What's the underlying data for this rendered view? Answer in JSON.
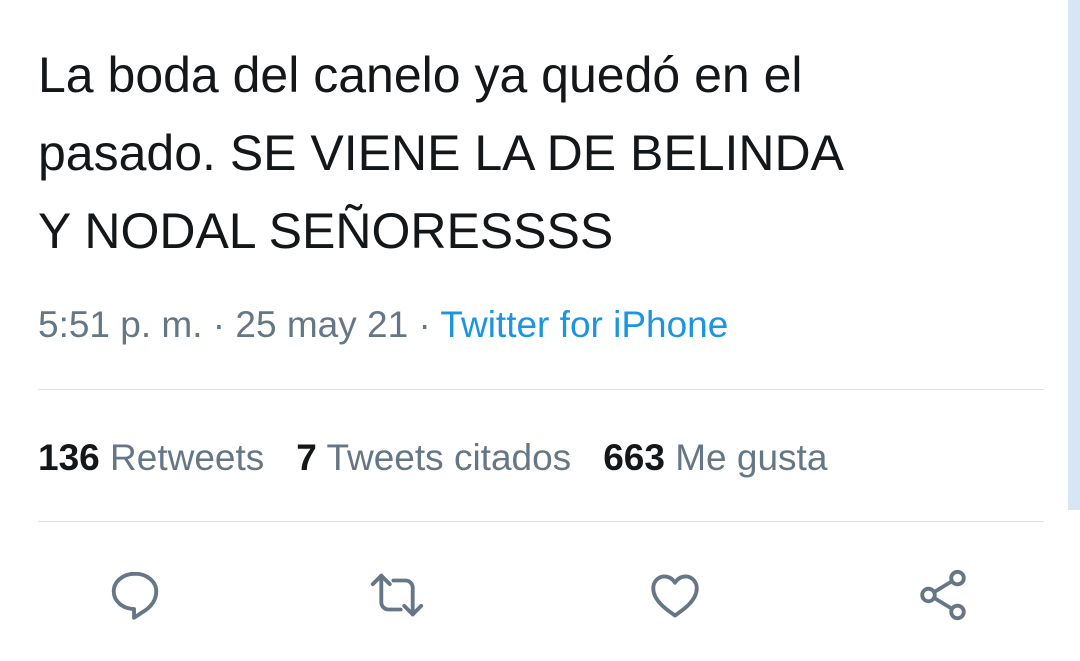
{
  "tweet": {
    "text": "La boda del canelo ya quedó en el\npasado. SE VIENE LA DE BELINDA\nY NODAL SEÑORESSSS",
    "time": "5:51 p. m.",
    "separator": " · ",
    "date": "25 may 21",
    "source": "Twitter for iPhone"
  },
  "stats": {
    "retweets_count": "136",
    "retweets_label": "Retweets",
    "quotes_count": "7",
    "quotes_label": "Tweets citados",
    "likes_count": "663",
    "likes_label": "Me gusta"
  },
  "actions": [
    {
      "icon": "reply-icon"
    },
    {
      "icon": "retweet-icon"
    },
    {
      "icon": "like-icon"
    },
    {
      "icon": "share-icon"
    }
  ],
  "colors": {
    "text": "#14171a",
    "secondary": "#657786",
    "accent": "#1b95e0",
    "divider": "#dbe3e8"
  }
}
